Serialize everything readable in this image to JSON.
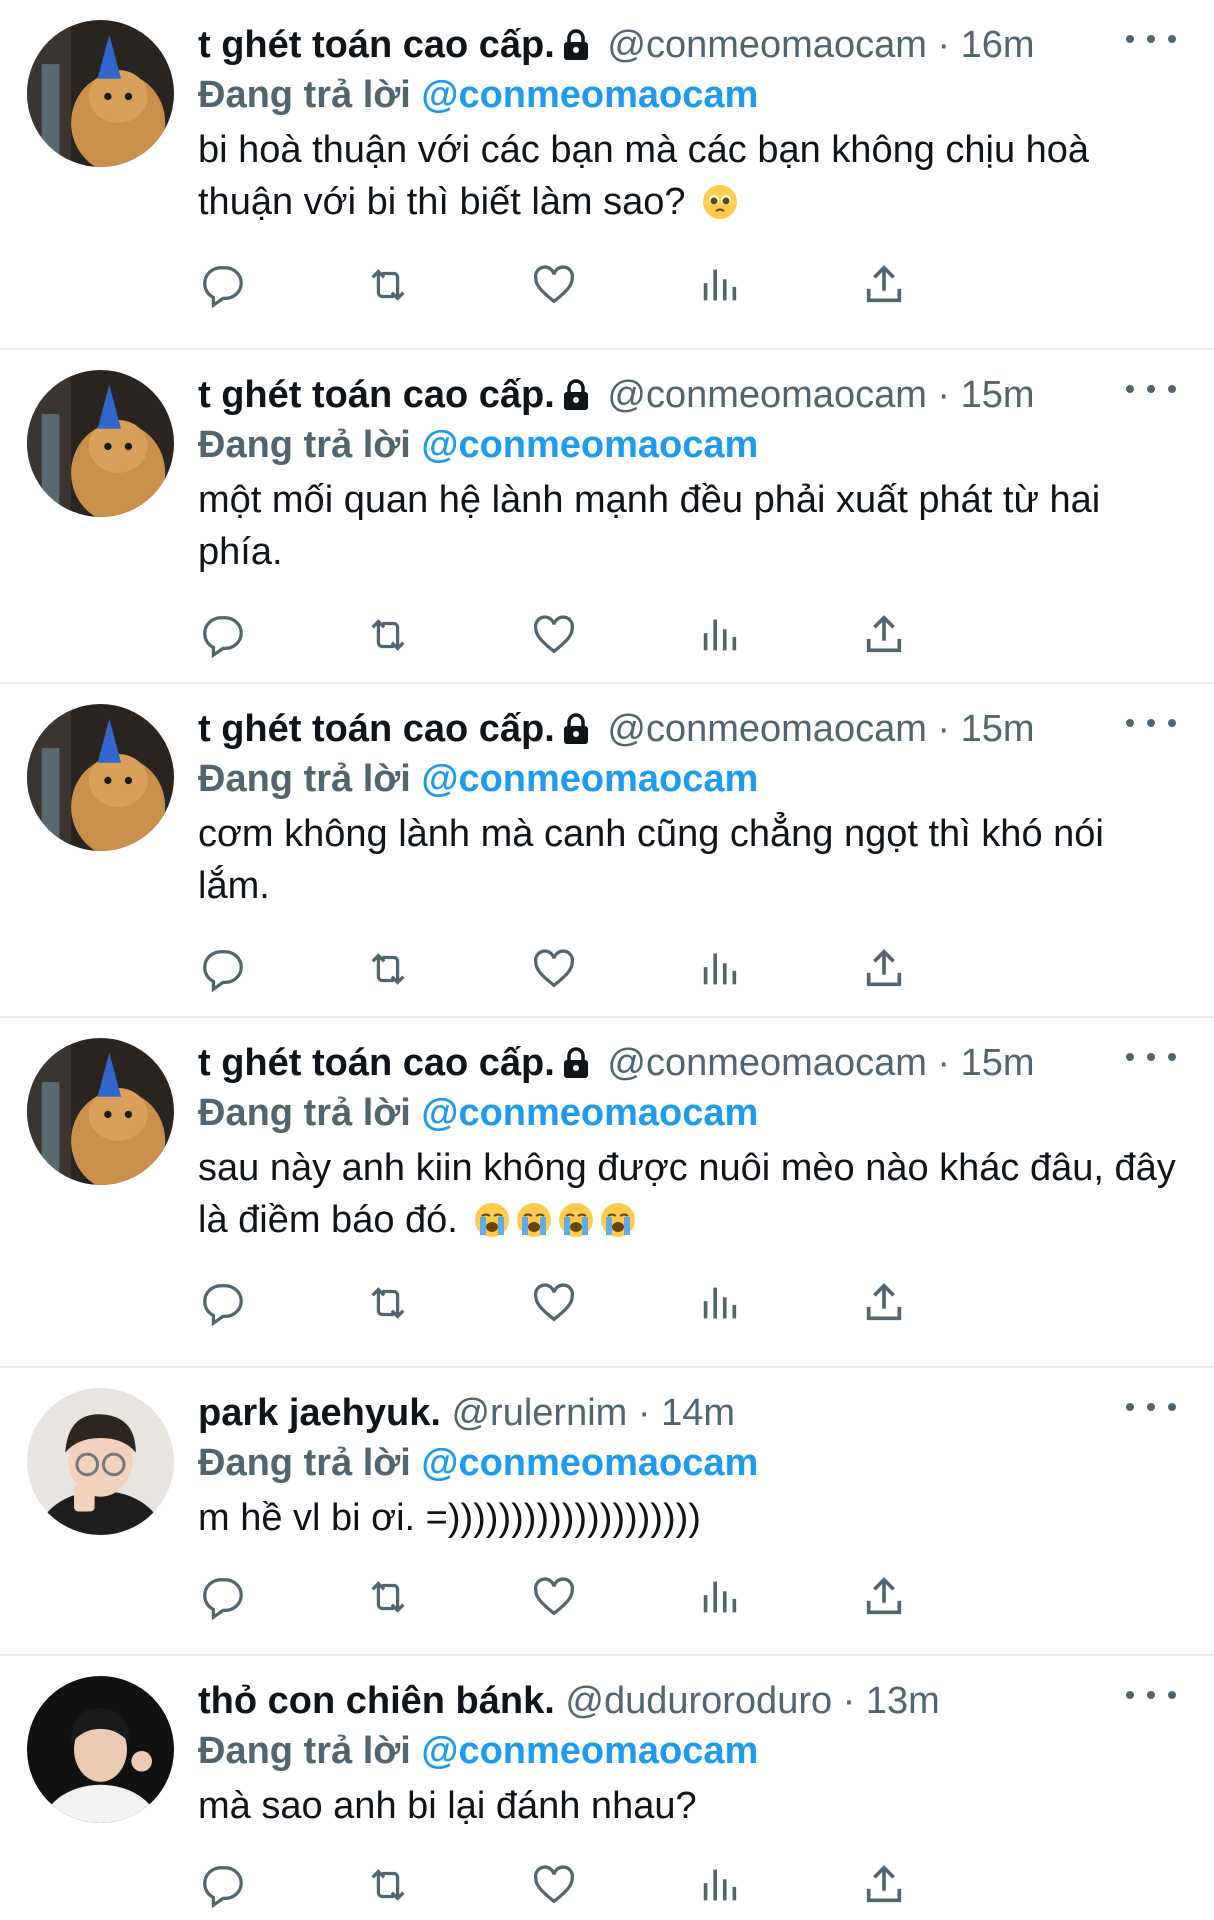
{
  "colors": {
    "accent": "#1d9bf0",
    "text": "#0f1419",
    "secondary": "#536471",
    "divider": "#e6ecf0"
  },
  "tweets": [
    {
      "name": "t ghét toán cao cấp.",
      "locked": true,
      "handle": "@conmeomaocam",
      "time": "16m",
      "reply_prefix": "Đang trả lời",
      "reply_to": "@conmeomaocam",
      "text": "bi hoà thuận với các bạn mà các bạn không chịu hoà thuận với bi thì biết làm sao?",
      "emojis": [
        "pleading-face"
      ],
      "avatar": "cat-avatar"
    },
    {
      "name": "t ghét toán cao cấp.",
      "locked": true,
      "handle": "@conmeomaocam",
      "time": "15m",
      "reply_prefix": "Đang trả lời",
      "reply_to": "@conmeomaocam",
      "text": "một mối quan hệ lành mạnh đều phải xuất phát từ hai phía.",
      "emojis": [],
      "avatar": "cat-avatar"
    },
    {
      "name": "t ghét toán cao cấp.",
      "locked": true,
      "handle": "@conmeomaocam",
      "time": "15m",
      "reply_prefix": "Đang trả lời",
      "reply_to": "@conmeomaocam",
      "text": "cơm không lành mà canh cũng chẳng ngọt thì khó nói lắm.",
      "emojis": [],
      "avatar": "cat-avatar"
    },
    {
      "name": "t ghét toán cao cấp.",
      "locked": true,
      "handle": "@conmeomaocam",
      "time": "15m",
      "reply_prefix": "Đang trả lời",
      "reply_to": "@conmeomaocam",
      "text": "sau này anh kiin không được nuôi mèo nào khác đâu, đây là điềm báo đó.",
      "emojis": [
        "loudly-crying-face",
        "loudly-crying-face",
        "loudly-crying-face",
        "loudly-crying-face"
      ],
      "avatar": "cat-avatar"
    },
    {
      "name": "park jaehyuk.",
      "locked": false,
      "handle": "@rulernim",
      "time": "14m",
      "reply_prefix": "Đang trả lời",
      "reply_to": "@conmeomaocam",
      "text": "m hề vl bi ơi. =))))))))))))))))))))",
      "emojis": [],
      "avatar": "person-glasses-avatar"
    },
    {
      "name": "thỏ con chiên bánk.",
      "locked": false,
      "handle": "@duduroroduro",
      "time": "13m",
      "reply_prefix": "Đang trả lời",
      "reply_to": "@conmeomaocam",
      "text": "mà sao anh bi lại đánh nhau?",
      "emojis": [],
      "avatar": "person-dark-avatar"
    }
  ],
  "action_icons": [
    "reply-icon",
    "retweet-icon",
    "like-icon",
    "views-icon",
    "share-icon"
  ]
}
